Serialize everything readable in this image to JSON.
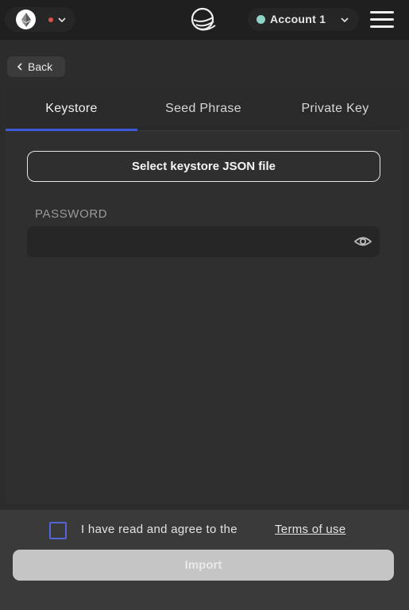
{
  "header": {
    "network_icon": "ethereum-icon",
    "network_status_color": "#d9534f",
    "account": {
      "name": "Account 1",
      "status_color": "#8fd3c7"
    },
    "menu_icon": "hamburger-menu-icon"
  },
  "nav": {
    "back_label": "Back"
  },
  "tabs": [
    {
      "label": "Keystore",
      "active": true
    },
    {
      "label": "Seed Phrase",
      "active": false
    },
    {
      "label": "Private Key",
      "active": false
    }
  ],
  "keystore": {
    "select_file_label": "Select keystore JSON file",
    "password_label": "PASSWORD",
    "password_value": ""
  },
  "footer": {
    "agree_text": "I have read and agree to the",
    "terms_link": "Terms of use",
    "import_label": "Import"
  },
  "colors": {
    "accent": "#3d5bd9"
  }
}
